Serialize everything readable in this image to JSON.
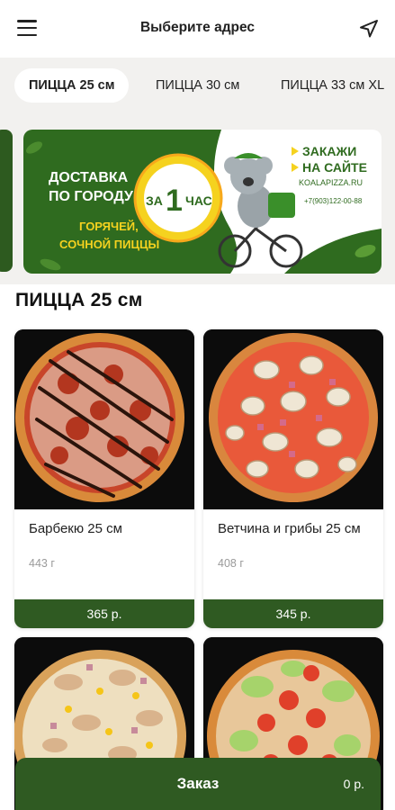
{
  "header": {
    "title": "Выберите адрес",
    "menu_icon": "hamburger-menu-icon",
    "location_icon": "navigation-arrow-icon"
  },
  "tabs": [
    {
      "label": "ПИЦЦА 25 см",
      "active": true
    },
    {
      "label": "ПИЦЦА 30 см",
      "active": false
    },
    {
      "label": "ПИЦЦА 33 см XL",
      "active": false
    }
  ],
  "banner": {
    "line1": "ДОСТАВКА",
    "line2": "ПО ГОРОДУ",
    "badge_small": "ЗА",
    "badge_big": "1",
    "badge_word": "ЧАС",
    "sub1": "ГОРЯЧЕЙ,",
    "sub2": "СОЧНОЙ ПИЦЦЫ",
    "cta1": "ЗАКАЖИ",
    "cta2": "НА САЙТЕ",
    "site": "KOALAPIZZA.RU",
    "phone": "+7(903)122-00-88",
    "accent": "#2f6b1f",
    "yellow": "#f5d21f",
    "green_light": "#8fc63f"
  },
  "section": {
    "title": "ПИЦЦА 25 см"
  },
  "products": [
    {
      "name": "Барбекю 25 см",
      "weight": "443 г",
      "price": "365 р."
    },
    {
      "name": "Ветчина и грибы 25 см",
      "weight": "408 г",
      "price": "345 р."
    },
    {
      "name": "",
      "weight": "",
      "price": ""
    },
    {
      "name": "",
      "weight": "",
      "price": ""
    }
  ],
  "order": {
    "label": "Заказ",
    "total": "0 р."
  },
  "colors": {
    "primary_green": "#2f5a22",
    "tab_bar_bg": "#f2f1ef"
  }
}
